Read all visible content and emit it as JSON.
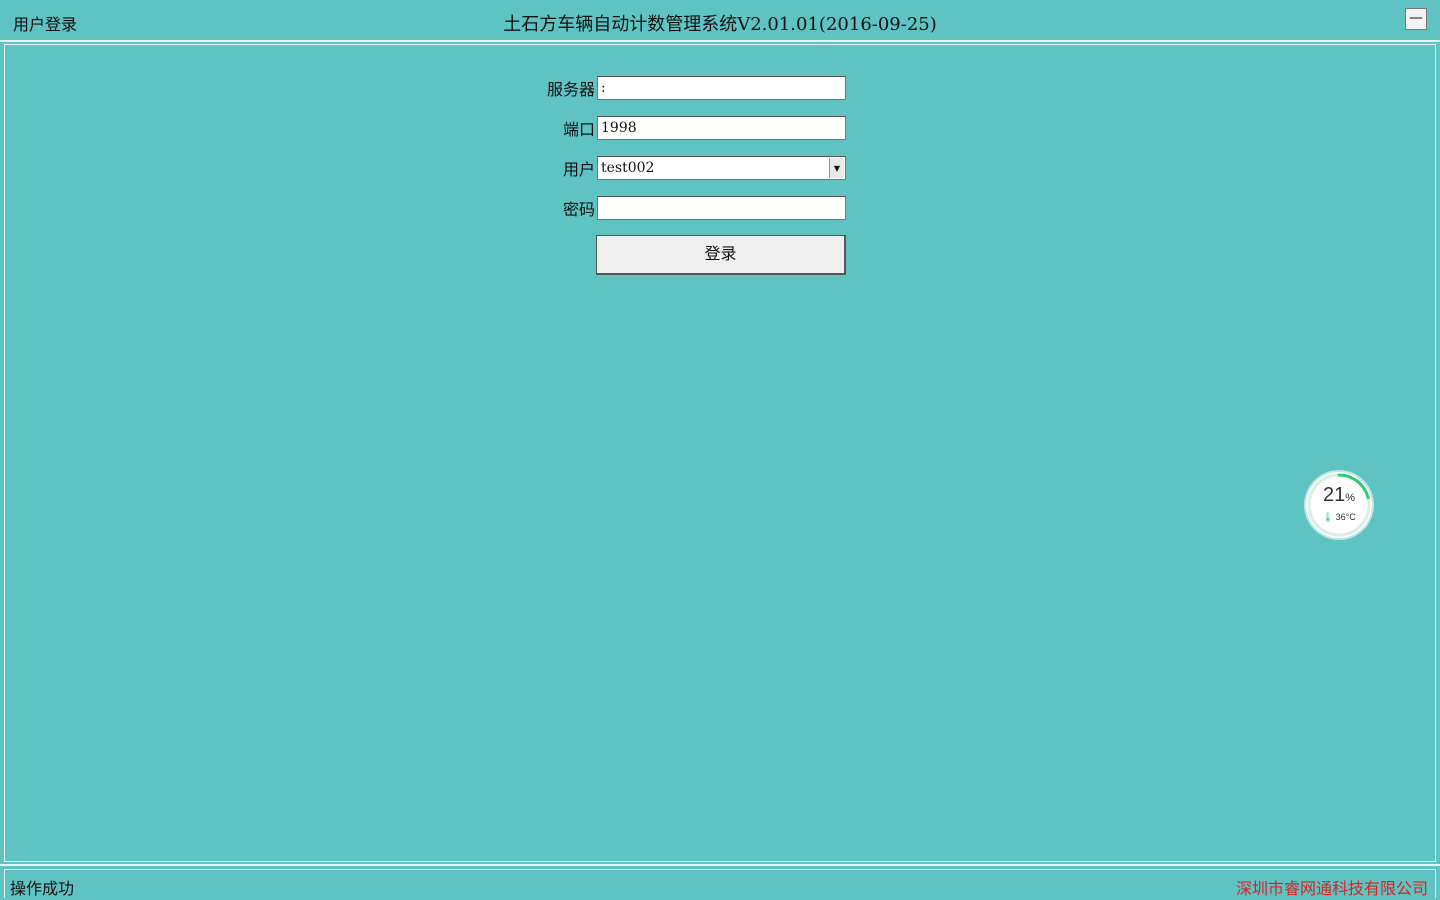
{
  "window": {
    "left_title": "用户登录",
    "title": "土石方车辆自动计数管理系统V2.01.01(2016-09-25)",
    "minimize_label": "—"
  },
  "form": {
    "server_label": "服务器",
    "server_value": ":",
    "port_label": "端口",
    "port_value": "1998",
    "user_label": "用户",
    "user_value": "test002",
    "password_label": "密码",
    "password_value": "",
    "login_label": "登录"
  },
  "gauge": {
    "percent": "21",
    "percent_unit": "%",
    "temperature": "36°C",
    "accent": "#2ecc71"
  },
  "statusbar": {
    "status": "操作成功",
    "company": "深圳市睿网通科技有限公司"
  },
  "colors": {
    "background": "#5fc3c3",
    "company_text": "#e02020"
  }
}
